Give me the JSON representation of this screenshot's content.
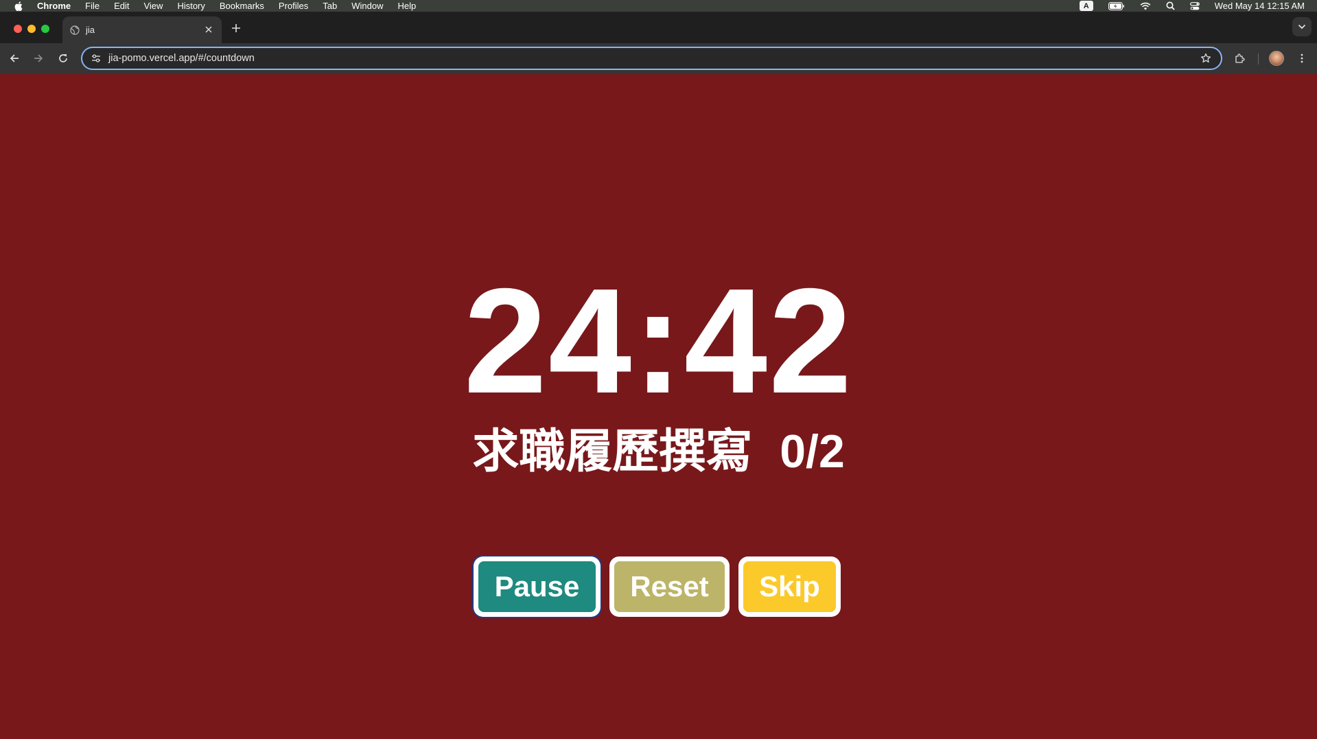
{
  "menubar": {
    "items": [
      "Chrome",
      "File",
      "Edit",
      "View",
      "History",
      "Bookmarks",
      "Profiles",
      "Tab",
      "Window",
      "Help"
    ],
    "input_indicator": "A",
    "clock": "Wed May 14  12:15 AM"
  },
  "browser": {
    "tab_title": "jia",
    "url": "jia-pomo.vercel.app/#/countdown",
    "accent": "#8ab4f8"
  },
  "page": {
    "background": "#78181b",
    "timer": "24:42",
    "task_name": "求職履歷撰寫",
    "task_count": "0/2",
    "buttons": {
      "pause": "Pause",
      "reset": "Reset",
      "skip": "Skip"
    },
    "button_colors": {
      "pause": "#1e8a80",
      "reset": "#bcb468",
      "skip": "#fbc92a"
    }
  }
}
